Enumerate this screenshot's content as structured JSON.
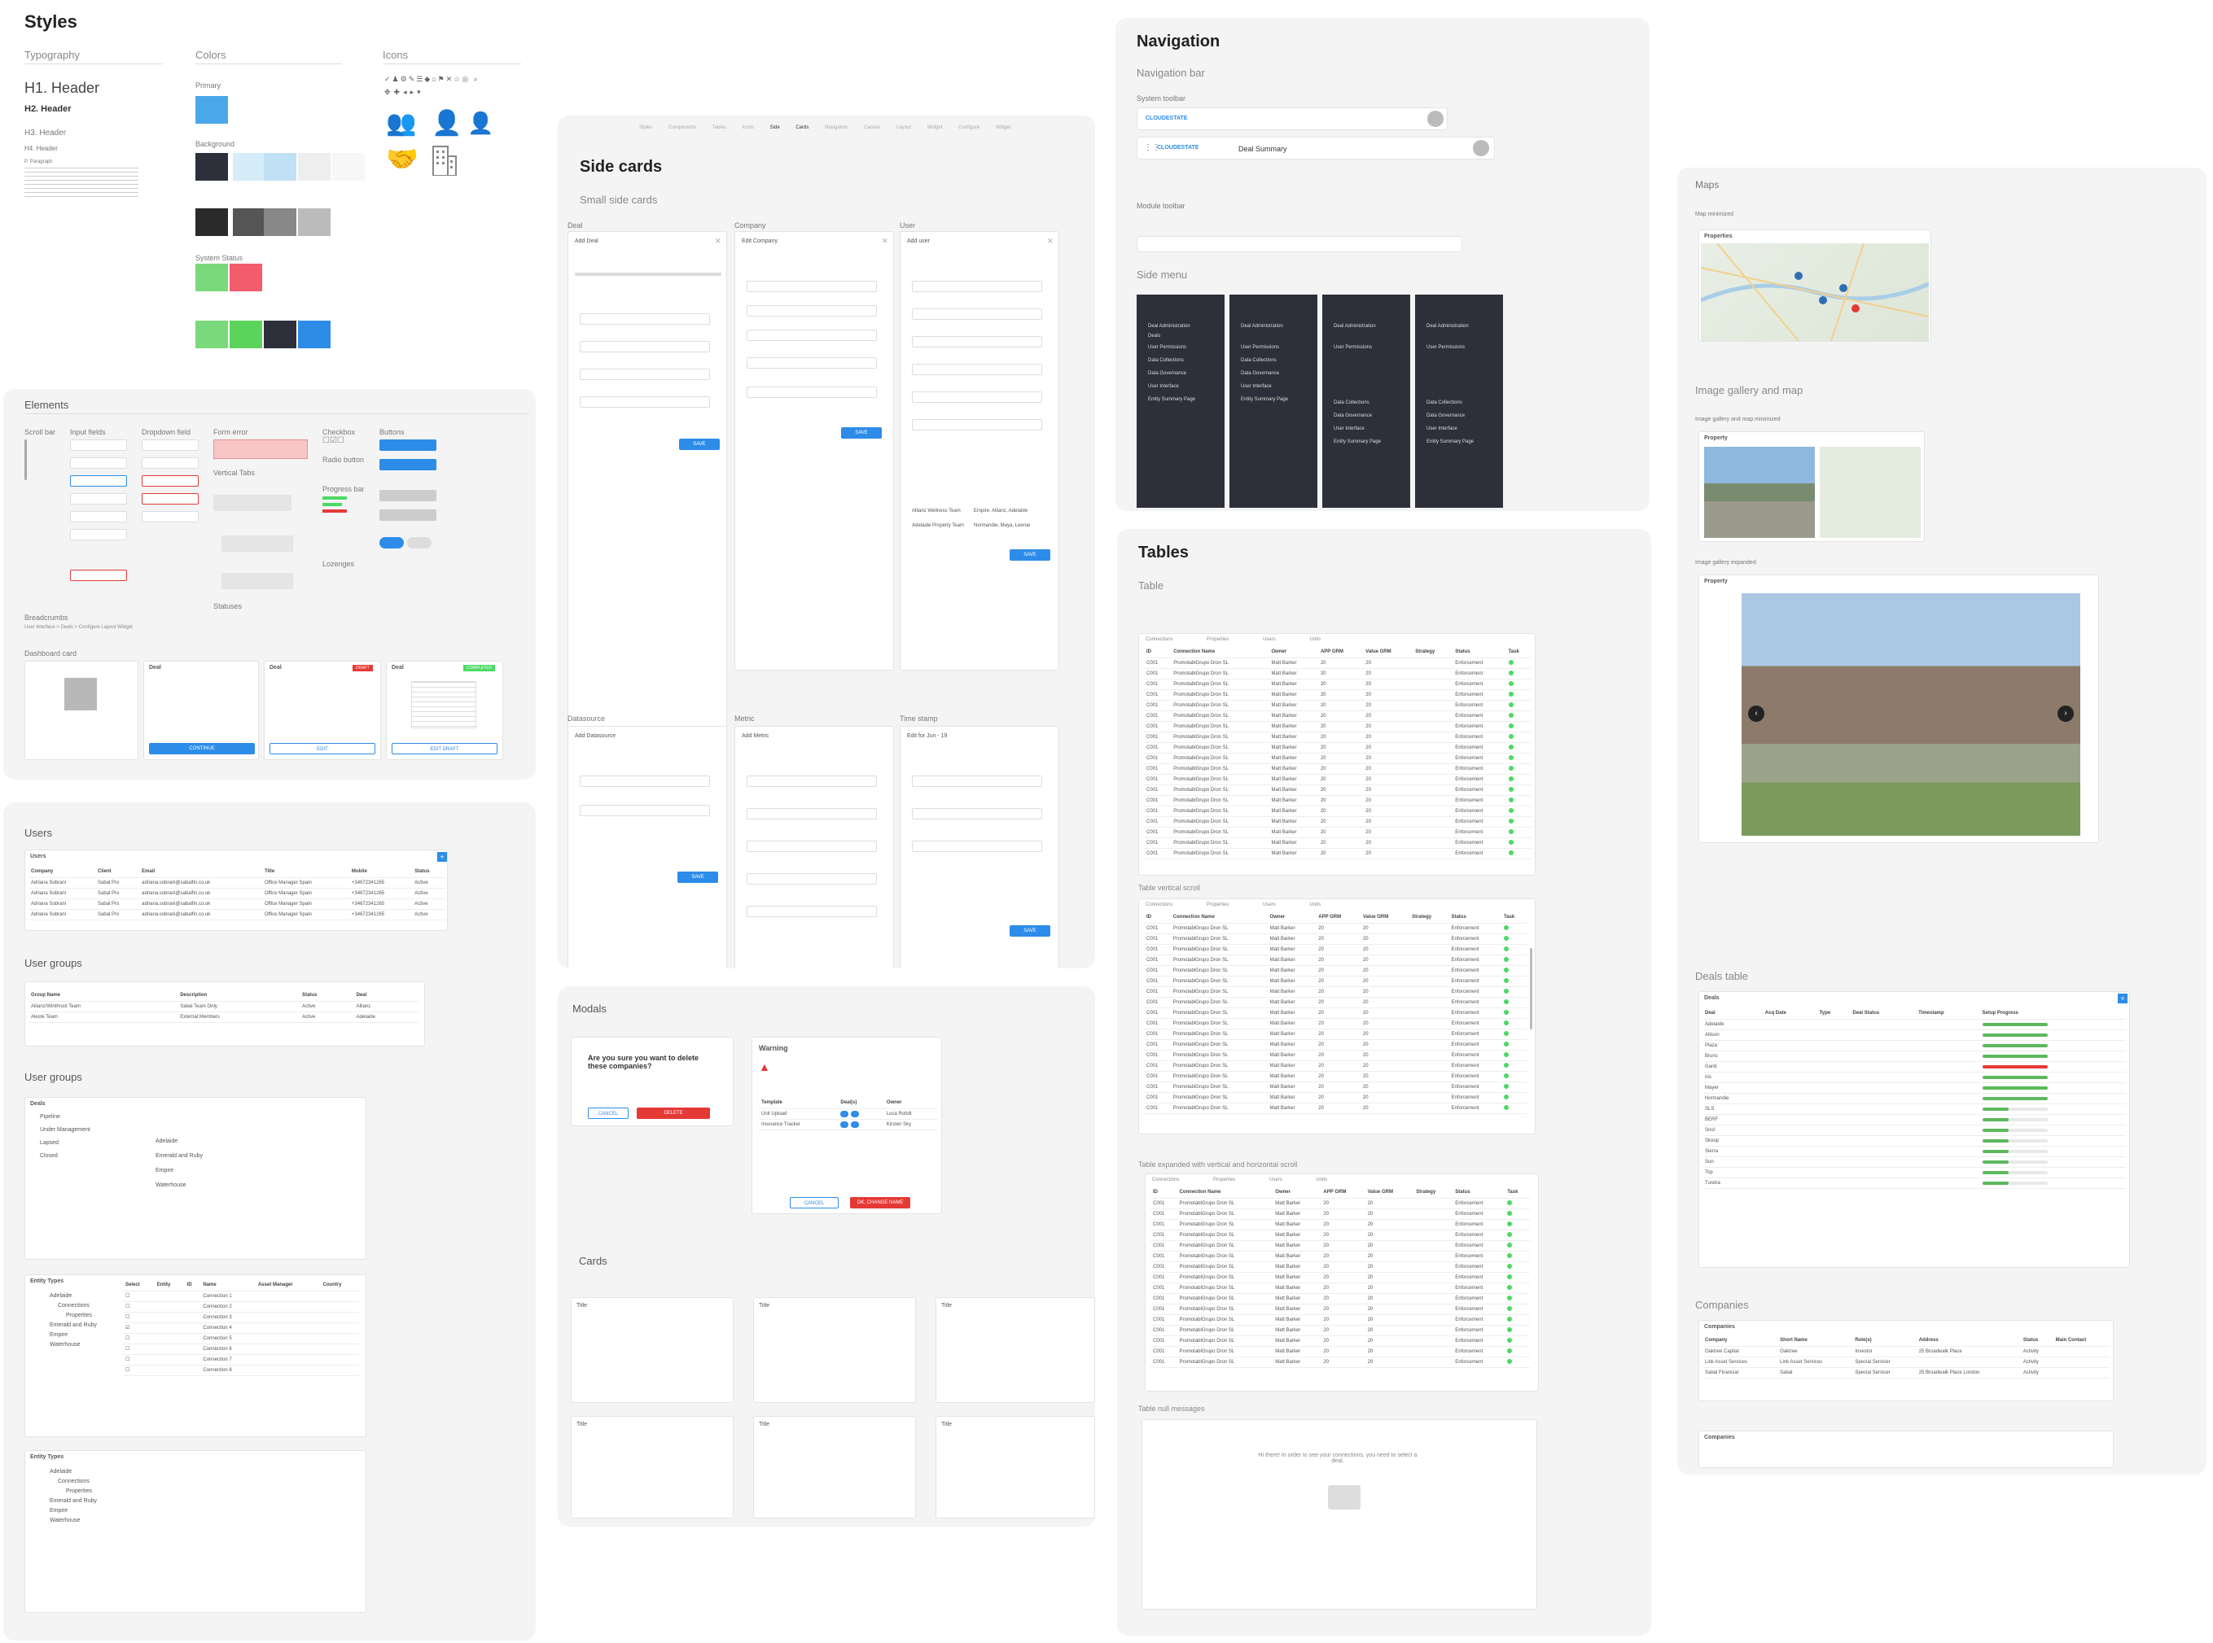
{
  "styles": {
    "title": "Styles",
    "typography": "Typography",
    "colors": "Colors",
    "icons": "Icons",
    "h1": "H1. Header",
    "h2": "H2. Header",
    "h3": "H3. Header",
    "h4": "H4. Header",
    "paragraph": "P. Paragraph",
    "primary": "Primary",
    "background": "Background",
    "status": "System Status"
  },
  "elements": {
    "title": "Elements",
    "scrollbar": "Scroll bar",
    "input": "Input fields",
    "dropdown": "Dropdown field",
    "formerror": "Form error",
    "checkbox": "Checkbox",
    "radio": "Radio button",
    "buttons": "Buttons",
    "vtabs": "Vertical Tabs",
    "progress": "Progress bar",
    "lozenges": "Lozenges",
    "statuses": "Statuses",
    "breadcrumbs": "Breadcrumbs",
    "dashboard": "Dashboard card",
    "deal": "Deal",
    "draft": "DRAFT",
    "completed": "COMPLETED",
    "bc_path": "User Interface > Deals > Configure Layout Widget",
    "continue": "CONTINUE",
    "edit": "EDIT",
    "edit_draft": "EDIT DRAFT"
  },
  "users": {
    "title": "Users",
    "table_title": "Users",
    "cols": [
      "Company",
      "Client",
      "Email",
      "Title",
      "Mobile",
      "Status"
    ],
    "rows": [
      [
        "Adriana Sobrani",
        "Sabal Pro",
        "adriana.sobrani@sabalfin.co.uk",
        "Office Manager Spain",
        "+34672341265",
        "Active"
      ],
      [
        "Adriana Sobrani",
        "Sabal Pro",
        "adriana.sobrani@sabalfin.co.uk",
        "Office Manager Spain",
        "+34672341265",
        "Active"
      ],
      [
        "Adriana Sobrani",
        "Sabal Pro",
        "adriana.sobrani@sabalfin.co.uk",
        "Office Manager Spain",
        "+34672341265",
        "Active"
      ],
      [
        "Adriana Sobrani",
        "Sabal Pro",
        "adriana.sobrani@sabalfin.co.uk",
        "Office Manager Spain",
        "+34672341265",
        "Active"
      ]
    ],
    "ug_title": "User groups",
    "ug_cols": [
      "Group Name",
      "Description",
      "Status",
      "Deal"
    ],
    "ug_rows": [
      [
        "Allianz/Winthrust Team",
        "Sabal Team Only",
        "Active",
        "Allianz"
      ],
      [
        "Aleste Team",
        "External Members",
        "Active",
        "Adelaide"
      ]
    ],
    "ug2_title": "User groups",
    "deals": "Deals",
    "deal_items": [
      "Pipeline",
      "Under Management",
      "Lapsed",
      "Closed"
    ],
    "deal_names": [
      "Adelaide",
      "Emerald and Ruby",
      "Empire",
      "Waterhouse"
    ],
    "et_title": "Entity Types",
    "et_items": [
      "Adelaide",
      "Connections",
      "Properties",
      "Emerald and Ruby",
      "Empire",
      "Waterhouse"
    ],
    "et_cols": [
      "Select",
      "Entity",
      "ID",
      "Name",
      "Asset Manager",
      "Country"
    ],
    "et_names": [
      "Connection 1",
      "Connection 2",
      "Connection 3",
      "Connection 4",
      "Connection 5",
      "Connection 6",
      "Connection 7",
      "Connection 8"
    ]
  },
  "side": {
    "title": "Side cards",
    "subtitle": "Small side cards",
    "tabs": [
      "Styles",
      "Components",
      "Tables",
      "Icons",
      "Side Cards",
      "Navigation",
      "Canvas",
      "Layout Widget",
      "Configure Widget"
    ],
    "deal": "Deal",
    "company": "Company",
    "user": "User",
    "add_deal": "Add Deal",
    "edit_company": "Edit Company",
    "add_user": "Add user",
    "datasource": "Datasource",
    "metric": "Metric",
    "timestamp": "Time stamp",
    "add_ds": "Add Datasource",
    "add_metric": "Add Metric",
    "edit_ts": "Edit for Jun - 19",
    "save": "SAVE",
    "user_rows": [
      [
        "Allianz Wellness Team",
        "Empire, Allianz, Adelaide"
      ],
      [
        "Adelaide Property Team",
        "Normandie, Maya, Leeroe"
      ]
    ]
  },
  "modals": {
    "title": "Modals",
    "q": "Are you sure you want to delete these companies?",
    "cancel": "CANCEL",
    "delete": "DELETE",
    "warning": "Warning",
    "tcols": [
      "Template",
      "Deal(s)",
      "Owner"
    ],
    "trows": [
      [
        "Unit Upload",
        "Luca Rohdt"
      ],
      [
        "Insurance Tracker",
        "Kirsten Sky"
      ]
    ],
    "confirm": "OK, CHANGE NAME"
  },
  "cards": {
    "title": "Cards",
    "card": "Title"
  },
  "nav": {
    "title": "Navigation",
    "bar": "Navigation bar",
    "systool": "System toolbar",
    "brand": "CLOUDESTATE",
    "deal_summary": "Deal Summary",
    "module": "Module toolbar",
    "side_menu": "Side menu",
    "items": [
      "Deal Administration",
      "Deals",
      "User Permissions",
      "Data Collections",
      "Data Governance",
      "User Interface",
      "Entity Summary Page"
    ]
  },
  "tables": {
    "title": "Tables",
    "sub": "Table",
    "tabs": [
      "Connections",
      "Properties",
      "Users",
      "Units"
    ],
    "cols": [
      "ID",
      "Connection Name",
      "Owner",
      "APP GRM",
      "Value GRM",
      "Strategy",
      "Status",
      "Task"
    ],
    "row": [
      "C001",
      "PromotablGrupo Dron SL",
      "Matt Barker",
      "20",
      "20",
      "",
      "Enforcement"
    ],
    "vscroll": "Table vertical scroll",
    "hscroll": "Table expanded with vertical and horizontal scroll",
    "null": "Table null messages",
    "null_msg": "Hi there! In order to see your connections, you need to select a deal."
  },
  "maps": {
    "title": "Maps",
    "min": "Map minimized",
    "properties": "Properties",
    "gallery": "Image gallery and map",
    "gmin": "Image gallery and map minimized",
    "property": "Property",
    "gexp": "Image gallery expanded",
    "deals_table": "Deals table",
    "deals": "Deals",
    "dcols": [
      "Deal",
      "Acq Date",
      "Type",
      "Deal Status",
      "Timestamp",
      "Setup Progress"
    ],
    "dnames": [
      "Adelaide",
      "Allison",
      "Plaza",
      "Bruns",
      "Gardi",
      "Iris",
      "Mayer",
      "Normandie",
      "SLS",
      "BERF",
      "Snol",
      "Skoop",
      "Sierra",
      "Sun",
      "Top",
      "Tundra"
    ],
    "companies": "Companies",
    "ccols": [
      "Company",
      "Short Name",
      "Role(s)",
      "Address",
      "Status",
      "Main Contact"
    ],
    "crows": [
      [
        "Oaktree Capital",
        "Oaktree",
        "Investor",
        "25 Broadwalk Place",
        "Activity"
      ],
      [
        "Link Asset Services",
        "Link Asset Services",
        "Special Servicer",
        "",
        "Activity"
      ],
      [
        "Sabal Financial",
        "Sabal",
        "Special Servicer",
        "25 Broadwalk Place London",
        "Activity"
      ]
    ]
  },
  "colors": {
    "blue": "#2d8ce8",
    "dark": "#2d2f3a",
    "green": "#4cd964",
    "red": "#e53935"
  }
}
